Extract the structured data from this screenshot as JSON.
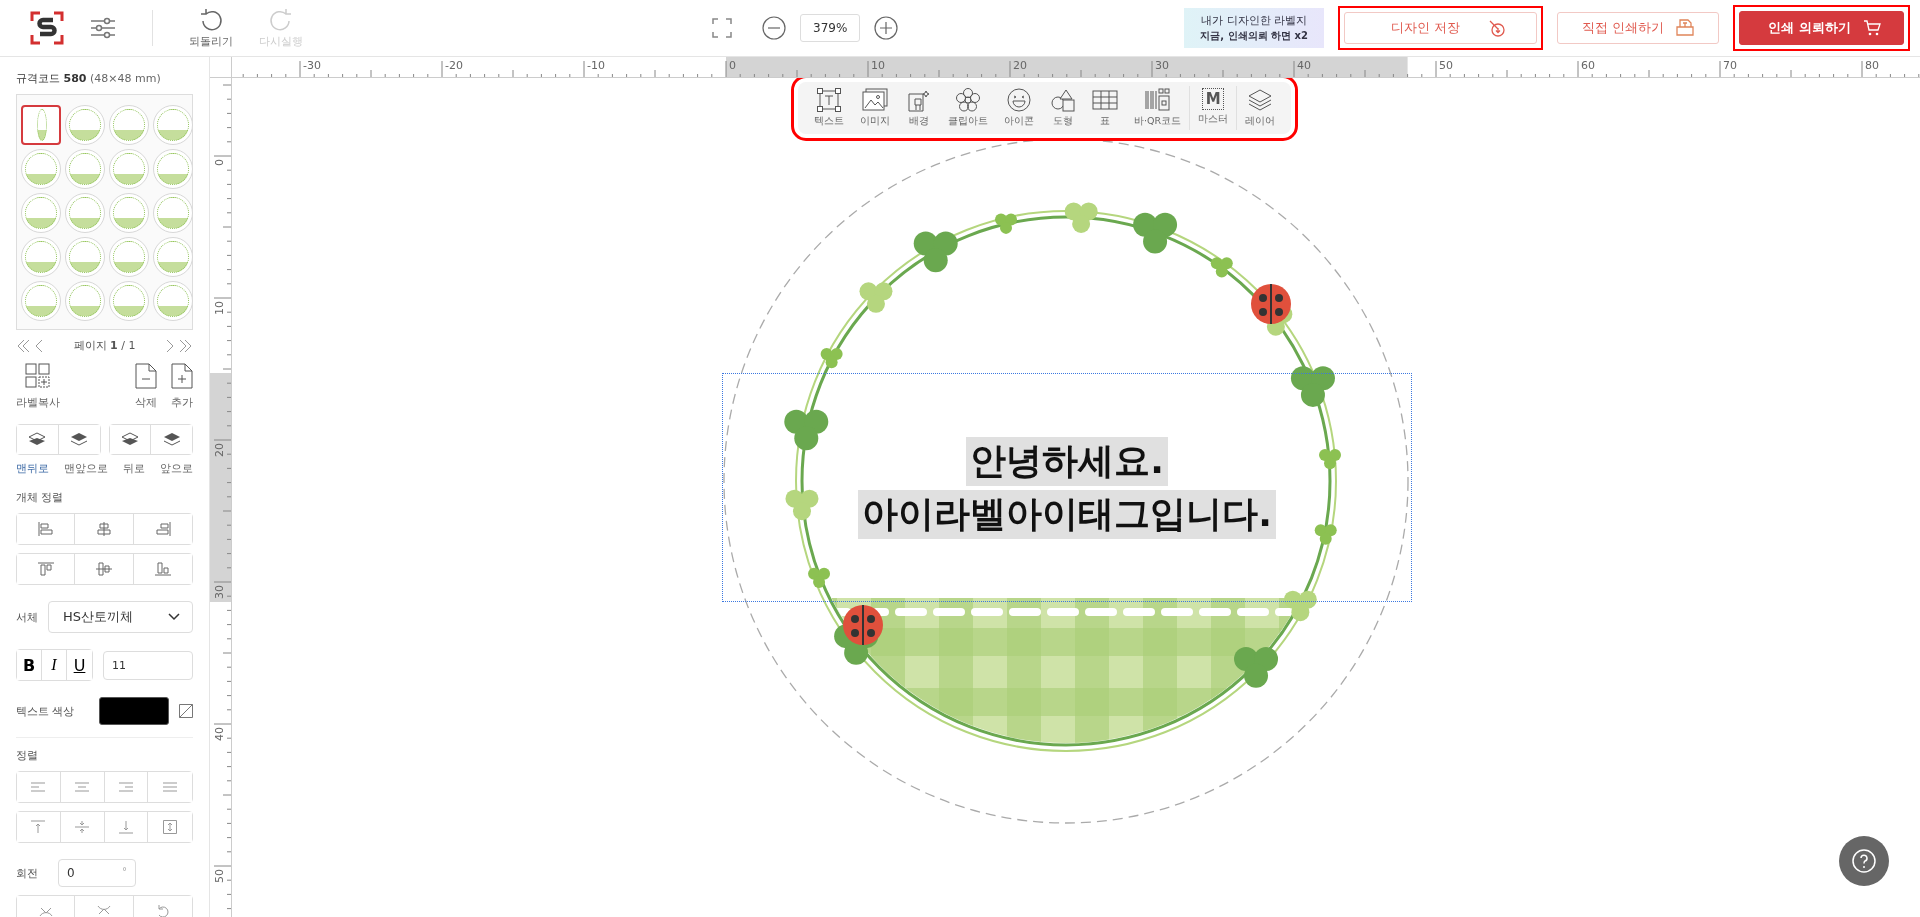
{
  "header": {
    "undo": {
      "label": "되돌리기",
      "disabled": false
    },
    "redo": {
      "label": "다시실행",
      "disabled": true
    },
    "zoom": "379%",
    "banner": {
      "line_1": "내가 디자인한 라벨지",
      "line_2": "지금, **인쇄의뢰** 하면 x2"
    },
    "buttons": [
      {
        "label": "디자인 저장",
        "kind": "save",
        "highlighted": true
      },
      {
        "label": "직접 인쇄하기",
        "kind": "print",
        "highlighted": false
      },
      {
        "label": "인쇄 의뢰하기",
        "kind": "order",
        "highlighted": true
      }
    ]
  },
  "ruler": {
    "horizontal": [
      "-30",
      "-20",
      "-10",
      "0",
      "10",
      "20",
      "30",
      "40",
      "50",
      "60",
      "70",
      "80"
    ],
    "vertical": [
      "0",
      "10",
      "20",
      "30",
      "40",
      "50"
    ]
  },
  "toolbar": {
    "highlighted": true,
    "tools": [
      {
        "label": "텍스트",
        "kind": "text"
      },
      {
        "label": "이미지",
        "kind": "image"
      },
      {
        "label": "배경",
        "kind": "background"
      },
      {
        "label": "클립아트",
        "kind": "clipart"
      },
      {
        "label": "아이콘",
        "kind": "icon"
      },
      {
        "label": "도형",
        "kind": "shape"
      },
      {
        "label": "표",
        "kind": "table"
      },
      {
        "label": "바·QR코드",
        "kind": "barcode"
      },
      {
        "label": "마스터",
        "kind": "master",
        "glyph": "M"
      },
      {
        "label": "레이어",
        "kind": "layer"
      }
    ]
  },
  "sidebar": {
    "spec_label": "규격코드",
    "spec_code": "580",
    "spec_size": "(48×48 mm)",
    "labels": [
      {
        "selected": true
      },
      {
        "selected": false
      },
      {
        "selected": false
      },
      {
        "selected": false
      },
      {
        "selected": false
      },
      {
        "selected": false
      },
      {
        "selected": false
      },
      {
        "selected": false
      },
      {
        "selected": false
      },
      {
        "selected": false
      },
      {
        "selected": false
      },
      {
        "selected": false
      },
      {
        "selected": false
      },
      {
        "selected": false
      },
      {
        "selected": false
      },
      {
        "selected": false
      },
      {
        "selected": false
      },
      {
        "selected": false
      },
      {
        "selected": false
      },
      {
        "selected": false
      }
    ],
    "page": "페이지 **1** / 1",
    "copy_label": "라벨복사",
    "delete_label": "삭제",
    "add_label": "추가",
    "order_buttons": [
      "맨뒤로",
      "맨앞으로",
      "뒤로",
      "앞으로"
    ],
    "align_heading": "개체 정렬",
    "font_label": "서체",
    "font": "HS산토끼체",
    "format_buttons": [
      "B",
      "I",
      "U"
    ],
    "font_size": "11",
    "color_label": "텍스트 색상",
    "text_align_heading": "정렬",
    "rotation_label": "회전",
    "rotation": "0",
    "rotation_unit": "°"
  },
  "canvas": {
    "lines": [
      "안녕하세요.",
      "아이라벨아이태그입니다."
    ]
  }
}
